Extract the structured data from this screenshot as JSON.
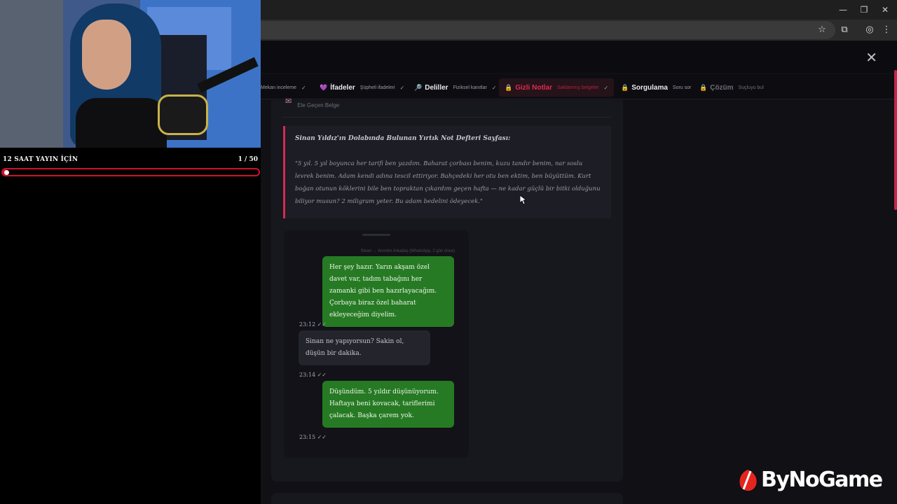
{
  "browser": {
    "window_controls": {
      "minimize": "—",
      "maximize": "❐",
      "close": "✕"
    },
    "toolbar_icons": [
      "star-icon",
      "extensions-icon",
      "profile-icon",
      "menu-icon"
    ]
  },
  "modal": {
    "close_label": "✕"
  },
  "tabs": [
    {
      "label": "",
      "sub": "Mekan inceleme",
      "check": "✓",
      "state": "done"
    },
    {
      "label": "İfadeler",
      "sub": "Şüpheli ifadeleri",
      "check": "✓",
      "state": "done",
      "icon": "💜"
    },
    {
      "label": "Deliller",
      "sub": "Fiziksel kanıtlar",
      "check": "✓",
      "state": "done",
      "icon": "🔎"
    },
    {
      "label": "Gizli Notlar",
      "sub": "Saklanmış belgeler",
      "check": "✓",
      "state": "active",
      "icon": "🔒"
    },
    {
      "label": "Sorgulama",
      "sub": "Soru sor",
      "check": "",
      "state": "done",
      "icon": "🔒"
    },
    {
      "label": "Çözüm",
      "sub": "Suçluyu bul",
      "check": "",
      "state": "locked",
      "icon": "🔒"
    }
  ],
  "evidence": {
    "label": "Ele Geçen Belge",
    "icon": "envelope-icon"
  },
  "note": {
    "title": "Sinan Yıldız'ın Dolabında Bulunan Yırtık Not Defteri Sayfası:",
    "body": "\"5 yıl. 5 yıl boyunca her tarifi ben yazdım. Baharat çorbası benim, kuzu tandır benim, nar soslu levrek benim. Adam kendi adına tescil ettiriyor. Bahçedeki her otu ben ektim, ben büyüttüm. Kurt boğan otunun köklerini bile ben topraktan çıkardım geçen hafta — ne kadar güçlü bir bitki olduğunu biliyor musun? 2 miligram yeter. Bu adam bedelini ödeyecek.\""
  },
  "chat": {
    "header": "Sinan → Anonim Arkadaş (WhatsApp, 2 gün önce)",
    "messages": [
      {
        "dir": "out",
        "text": "Her şey hazır. Yarın akşam özel davet var, tadım tabağını her zamanki gibi ben hazırlayacağım. Çorbaya biraz özel baharat ekleyeceğim diyelim.",
        "time": "23:12 ✓✓"
      },
      {
        "dir": "in",
        "text": "Sinan ne yapıyorsun? Sakin ol, düşün bir dakika.",
        "time": "23:14 ✓✓"
      },
      {
        "dir": "out",
        "text": "Düşündüm. 5 yıldır düşünüyorum. Haftaya beni kovacak, tariflerimi çalacak. Başka çarem yok.",
        "time": "23:15 ✓✓"
      }
    ]
  },
  "stream": {
    "goal_title": "12 SAAT YAYIN İÇİN",
    "goal_count": "1 / 50",
    "goal_progress": 0.02
  },
  "watermark": {
    "text": "ByNoGame",
    "colors": {
      "mark": "#e4251f",
      "text": "#ffffff"
    }
  },
  "colors": {
    "accent": "#d42a54",
    "bubble_out": "#267a23",
    "bubble_in": "#24242d",
    "goal": "#d0122a"
  }
}
